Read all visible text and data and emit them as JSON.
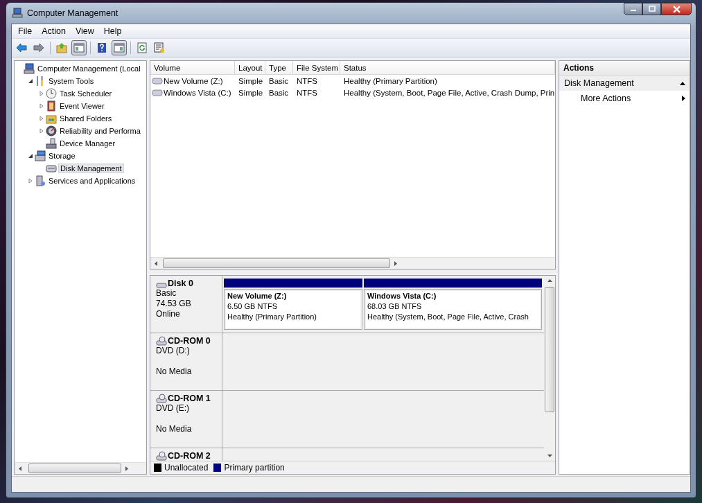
{
  "window": {
    "title": "Computer Management"
  },
  "menu": [
    "File",
    "Action",
    "View",
    "Help"
  ],
  "toolbar": [
    {
      "kind": "back",
      "pressed": false
    },
    {
      "kind": "forward",
      "pressed": false
    },
    {
      "kind": "separator"
    },
    {
      "kind": "up",
      "pressed": false
    },
    {
      "kind": "tree",
      "pressed": true
    },
    {
      "kind": "separator"
    },
    {
      "kind": "help",
      "pressed": false
    },
    {
      "kind": "actionpane",
      "pressed": true
    },
    {
      "kind": "separator"
    },
    {
      "kind": "refresh",
      "pressed": false
    },
    {
      "kind": "properties",
      "pressed": false
    }
  ],
  "tree": [
    {
      "label": "Computer Management (Local",
      "kind": "computer",
      "selected": false,
      "children": [
        {
          "label": "System Tools",
          "kind": "tools",
          "expanded": true,
          "selected": false,
          "children": [
            {
              "label": "Task Scheduler",
              "kind": "clock",
              "expanded": false,
              "selected": false
            },
            {
              "label": "Event Viewer",
              "kind": "log",
              "expanded": false,
              "selected": false
            },
            {
              "label": "Shared Folders",
              "kind": "folder",
              "expanded": false,
              "selected": false
            },
            {
              "label": "Reliability and Performa",
              "kind": "gauge",
              "expanded": false,
              "selected": false
            },
            {
              "label": "Device Manager",
              "kind": "device",
              "selected": false
            }
          ]
        },
        {
          "label": "Storage",
          "kind": "storage",
          "expanded": true,
          "selected": false,
          "children": [
            {
              "label": "Disk Management",
              "kind": "disk",
              "selected": true
            }
          ]
        },
        {
          "label": "Services and Applications",
          "kind": "services",
          "expanded": false,
          "selected": false
        }
      ]
    }
  ],
  "volumes": {
    "columns": [
      "Volume",
      "Layout",
      "Type",
      "File System",
      "Status"
    ],
    "rows": [
      [
        "New Volume (Z:)",
        "Simple",
        "Basic",
        "NTFS",
        "Healthy (Primary Partition)"
      ],
      [
        "Windows Vista (C:)",
        "Simple",
        "Basic",
        "NTFS",
        "Healthy (System, Boot, Page File, Active, Crash Dump, Prin"
      ]
    ]
  },
  "disks": [
    {
      "name": "Disk 0",
      "kind": "disk",
      "type": "Basic",
      "capacity": "74.53 GB",
      "status": "Online",
      "partitions": [
        {
          "name": "New Volume  (Z:)",
          "size": "6.50 GB NTFS",
          "status": "Healthy (Primary Partition)",
          "color": "#000080"
        },
        {
          "name": "Windows Vista  (C:)",
          "size": "68.03 GB NTFS",
          "status": "Healthy (System, Boot, Page File, Active, Crash",
          "color": "#000080"
        }
      ]
    },
    {
      "name": "CD-ROM 0",
      "kind": "cdrom",
      "type": "DVD (D:)",
      "status": "No Media"
    },
    {
      "name": "CD-ROM 1",
      "kind": "cdrom",
      "type": "DVD (E:)",
      "status": "No Media"
    },
    {
      "name": "CD-ROM 2",
      "kind": "cdrom"
    }
  ],
  "legend": [
    {
      "label": "Unallocated",
      "color": "#000000"
    },
    {
      "label": "Primary partition",
      "color": "#000080"
    }
  ],
  "actions": {
    "header": "Actions",
    "sections": [
      {
        "title": "Disk Management",
        "expanded": true,
        "items": [
          "More Actions"
        ]
      }
    ]
  }
}
